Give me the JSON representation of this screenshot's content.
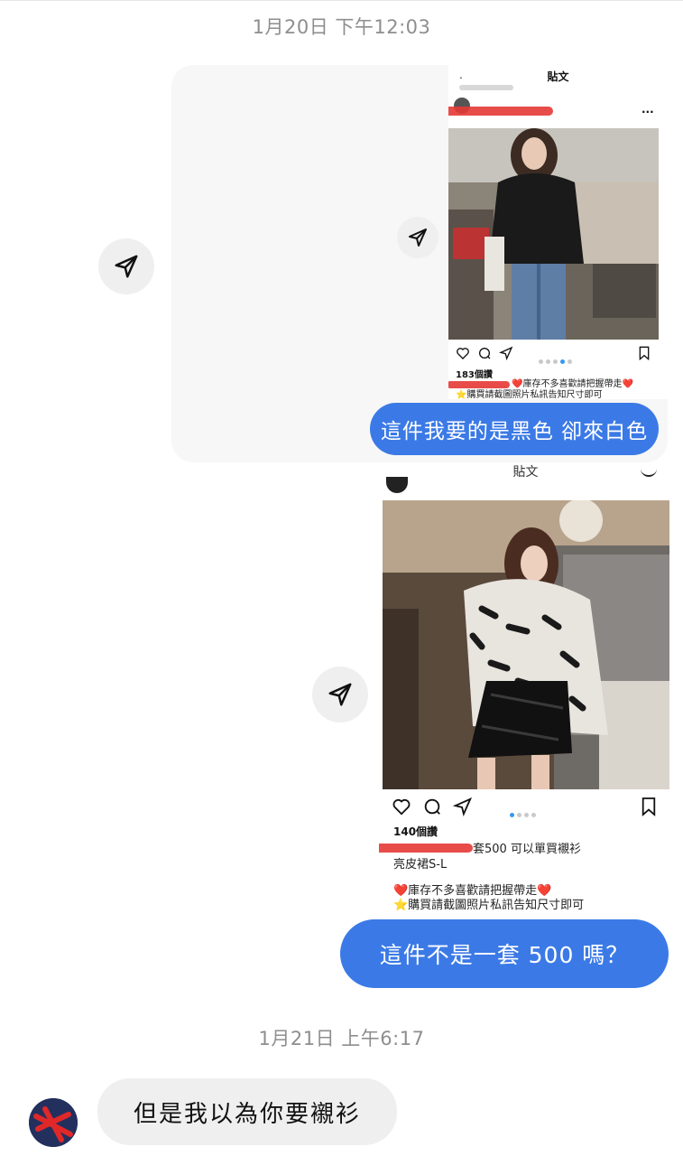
{
  "timestamps": {
    "first": "1月20日 下午12:03",
    "second": "1月21日 上午6:17"
  },
  "post1": {
    "header_title": "貼文",
    "more": "...",
    "views": "183個讚",
    "caption_line1": "❤️庫存不多喜歡請把握帶走❤️",
    "caption_line2": "⭐購買請截圖照片私訊告知尺寸即可"
  },
  "post2": {
    "header_title": "貼文",
    "views": "140個讚",
    "caption_line1": "套500 可以單買襯衫",
    "caption_line2": "亮皮裙S-L",
    "caption_line3": "❤️庫存不多喜歡請把握帶走❤️",
    "caption_line4": "⭐購買請截圖照片私訊告知尺寸即可"
  },
  "messages": {
    "sent1": "這件我要的是黑色 卻來白色",
    "sent2": "這件不是一套 500 嗎？",
    "received1": "但是我以為你要襯衫"
  },
  "colors": {
    "sent_bubble": "#3b7ae6",
    "received_bubble": "#efefef",
    "timestamp": "#8e8e8e"
  }
}
